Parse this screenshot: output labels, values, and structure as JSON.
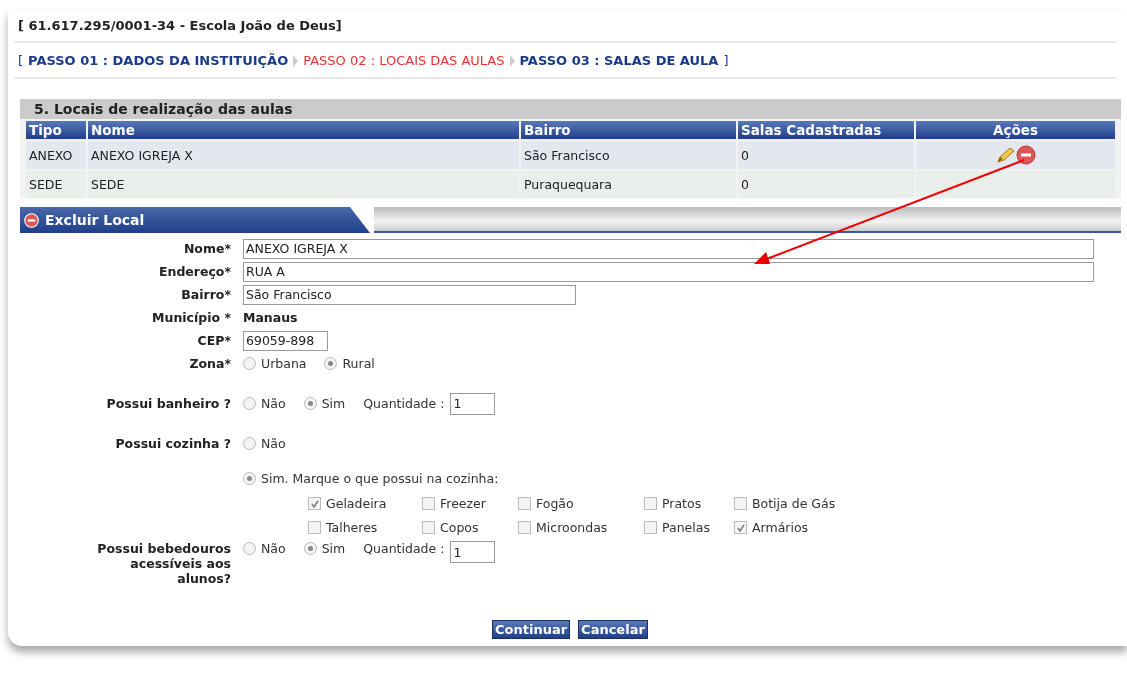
{
  "header": {
    "title": "[ 61.617.295/0001-34 - Escola João de Deus]"
  },
  "steps": {
    "open": "[",
    "close": "]",
    "items": [
      {
        "label": "PASSO 01 : DADOS DA INSTITUIÇÃO",
        "selected": false
      },
      {
        "label": "PASSO 02 : LOCAIS DAS AULAS",
        "selected": true
      },
      {
        "label": "PASSO 03 : SALAS DE AULA",
        "selected": false
      }
    ]
  },
  "section": {
    "title": "5. Locais de realização das aulas"
  },
  "table": {
    "columns": [
      "Tipo",
      "Nome",
      "Bairro",
      "Salas Cadastradas",
      "Ações"
    ],
    "rows": [
      {
        "cells": [
          "ANEXO",
          "ANEXO IGREJA X",
          "São Francisco",
          "0"
        ],
        "actions": true
      },
      {
        "cells": [
          "SEDE",
          "SEDE",
          "Puraquequara",
          "0"
        ],
        "actions": false
      }
    ]
  },
  "panel": {
    "title": "Excluir Local"
  },
  "form": {
    "nome": {
      "label": "Nome*",
      "value": "ANEXO IGREJA X"
    },
    "endereco": {
      "label": "Endereço*",
      "value": "RUA A"
    },
    "bairro": {
      "label": "Bairro*",
      "value": "São Francisco"
    },
    "municipio": {
      "label": "Município *",
      "value": "Manaus"
    },
    "cep": {
      "label": "CEP*",
      "value": "69059-898"
    },
    "zona": {
      "label": "Zona*",
      "options": [
        {
          "label": "Urbana",
          "selected": false
        },
        {
          "label": "Rural",
          "selected": true
        }
      ]
    },
    "banheiro": {
      "label": "Possui banheiro ?",
      "options": [
        {
          "label": "Não",
          "selected": false
        },
        {
          "label": "Sim",
          "selected": true
        }
      ],
      "quantity_label": "Quantidade :",
      "quantity": "1"
    },
    "cozinha": {
      "label": "Possui cozinha ?",
      "options": [
        {
          "label": "Não",
          "selected": false
        },
        {
          "label": "Sim. Marque o que possui na cozinha:",
          "selected": true
        }
      ],
      "items": [
        {
          "label": "Geladeira",
          "checked": true
        },
        {
          "label": "Freezer",
          "checked": false
        },
        {
          "label": "Fogão",
          "checked": false
        },
        {
          "label": "Pratos",
          "checked": false
        },
        {
          "label": "Botija de Gás",
          "checked": false
        },
        {
          "label": "Talheres",
          "checked": false
        },
        {
          "label": "Copos",
          "checked": false
        },
        {
          "label": "Microondas",
          "checked": false
        },
        {
          "label": "Panelas",
          "checked": false
        },
        {
          "label": "Armários",
          "checked": true
        }
      ]
    },
    "bebedouros": {
      "label": "Possui bebedouros acessíveis aos alunos?",
      "options": [
        {
          "label": "Não",
          "selected": false
        },
        {
          "label": "Sim",
          "selected": true
        }
      ],
      "quantity_label": "Quantidade :",
      "quantity": "1"
    }
  },
  "buttons": [
    "Continuar",
    "Cancelar"
  ]
}
